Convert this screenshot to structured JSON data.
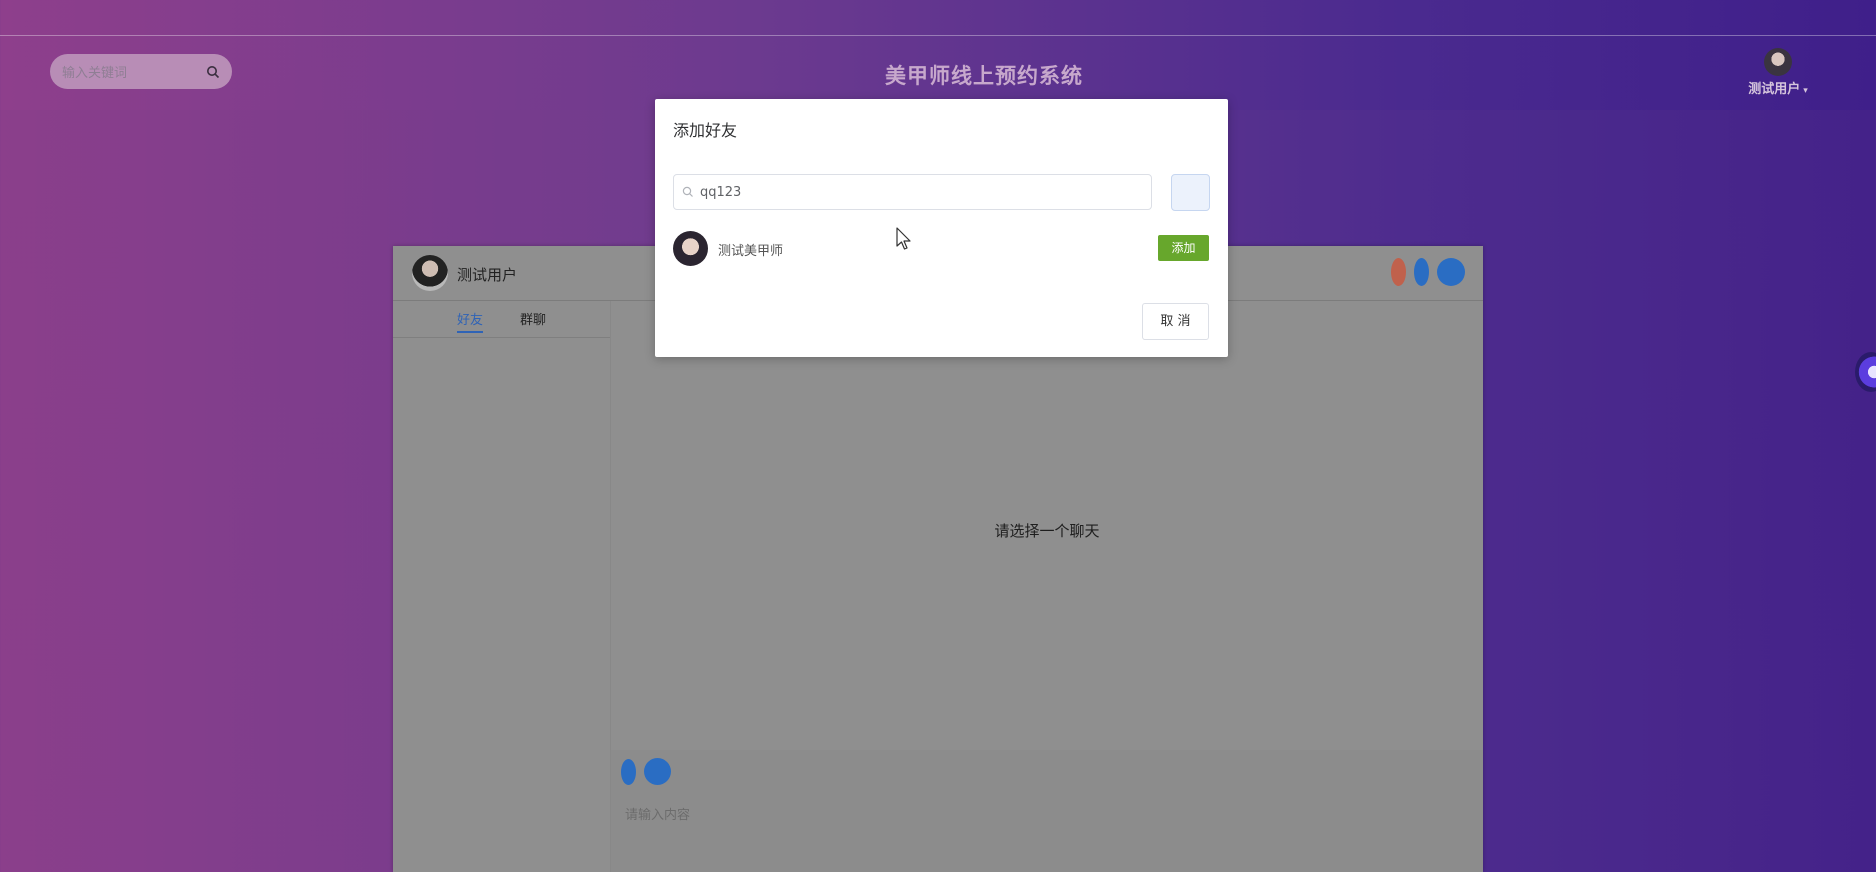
{
  "header": {
    "search_placeholder": "输入关键词",
    "site_title": "美甲师线上预约系统",
    "username": "测试用户",
    "caret": "▾"
  },
  "chat": {
    "current_user": "测试用户",
    "tabs": [
      "好友",
      "群聊"
    ],
    "empty_message": "请选择一个聊天",
    "input_placeholder": "请输入内容"
  },
  "dialog": {
    "title": "添加好友",
    "search_value": "qq123",
    "result_name": "测试美甲师",
    "add_label": "添加",
    "cancel_label": "取 消"
  },
  "colors": {
    "accent_blue": "#2a6dc3",
    "add_green": "#67a72c",
    "status_red": "#c0614c"
  }
}
